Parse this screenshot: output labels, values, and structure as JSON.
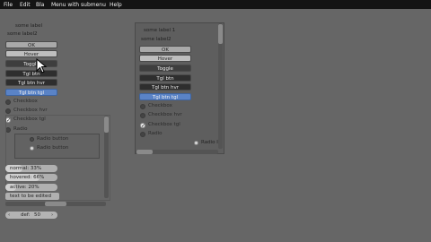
{
  "menubar": {
    "items": [
      "File",
      "Edit",
      "Bla",
      "Menu with submenu",
      "Help"
    ]
  },
  "left": {
    "label_some": "some label",
    "label_some2": "some label2",
    "buttons": {
      "ok": "OK",
      "hover": "Hover",
      "toggle": "Toggle",
      "tgl_btn": "Tgl btn",
      "tgl_btn_hvr": "Tgl btn hvr",
      "tgl_btn_tgl": "Tgl btn tgl"
    },
    "checkboxes": {
      "checkbox": "Checkbox",
      "checkbox_hvr": "Checkbox hvr",
      "checkbox_tgl": "Checkbox tgl",
      "radio": "Radio"
    },
    "radio_buttons": [
      "Radio button",
      "Radio button"
    ],
    "progress": [
      {
        "label": "normal",
        "value": "33%",
        "fraction": 0.33
      },
      {
        "label": "hovered",
        "value": "66%",
        "fraction": 0.66
      },
      {
        "label": "active",
        "value": "20%",
        "fraction": 0.2
      }
    ],
    "text_field": "text to be edited",
    "spinner": {
      "label": "def:",
      "value": "50"
    }
  },
  "right": {
    "label_some": "some label 1",
    "label_some2": "some label2",
    "buttons": {
      "ok": "OK",
      "hover": "Hover",
      "toggle": "Toggle",
      "tgl_btn": "Tgl btn",
      "tgl_btn_hvr": "Tgl btn hvr",
      "tgl_btn_tgl": "Tgl btn tgl"
    },
    "checkboxes": {
      "checkbox": "Checkbox",
      "checkbox_hvr": "Checkbox hvr",
      "checkbox_tgl": "Checkbox tgl",
      "radio": "Radio"
    },
    "radio_cut": "Radio I"
  }
}
